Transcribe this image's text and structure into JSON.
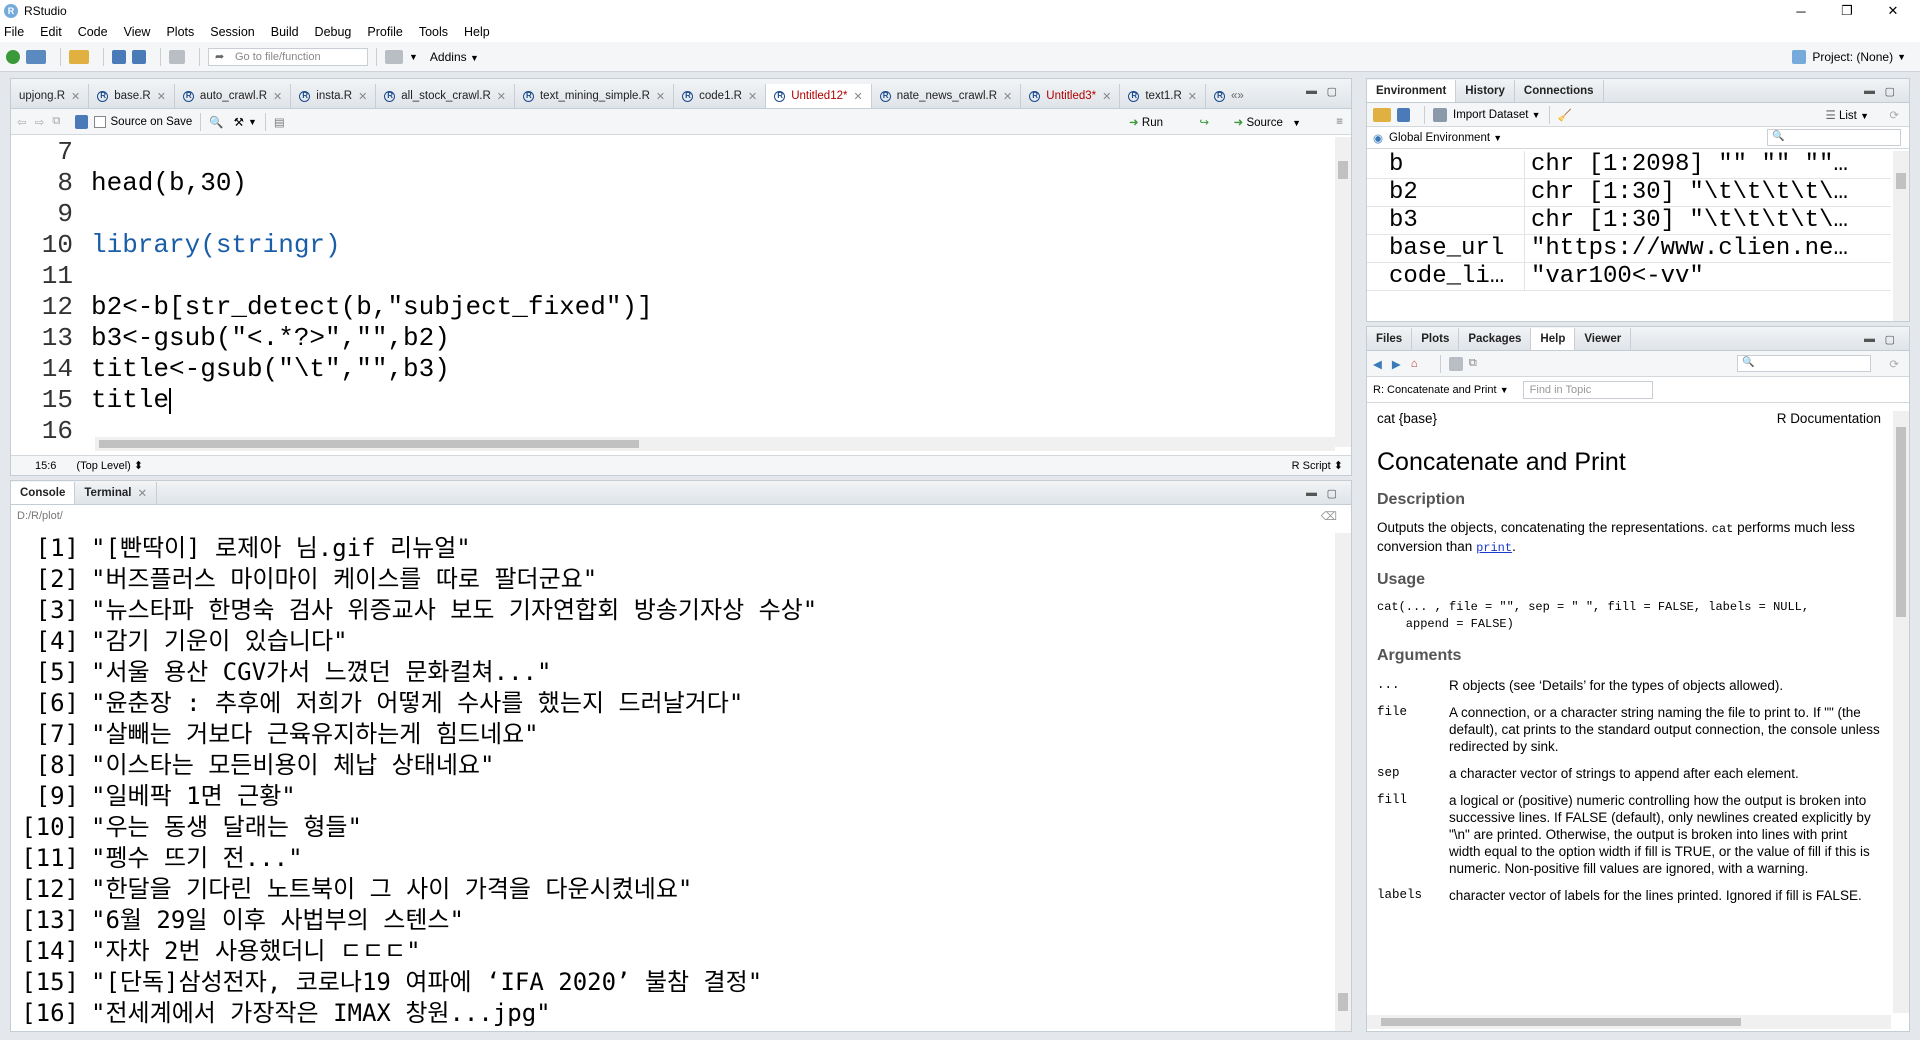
{
  "window": {
    "title": "RStudio",
    "min": "─",
    "max": "❐",
    "close": "✕"
  },
  "menu": [
    "File",
    "Edit",
    "Code",
    "View",
    "Plots",
    "Session",
    "Build",
    "Debug",
    "Profile",
    "Tools",
    "Help"
  ],
  "toolbar": {
    "goto_placeholder": "Go to file/function",
    "addins": "Addins",
    "project": "Project: (None)"
  },
  "editor": {
    "tabs": [
      {
        "label": "upjong.R",
        "unsaved": false,
        "active": false
      },
      {
        "label": "base.R",
        "unsaved": false,
        "active": false
      },
      {
        "label": "auto_crawl.R",
        "unsaved": false,
        "active": false
      },
      {
        "label": "insta.R",
        "unsaved": false,
        "active": false
      },
      {
        "label": "all_stock_crawl.R",
        "unsaved": false,
        "active": false
      },
      {
        "label": "text_mining_simple.R",
        "unsaved": false,
        "active": false
      },
      {
        "label": "code1.R",
        "unsaved": false,
        "active": false
      },
      {
        "label": "Untitled12*",
        "unsaved": true,
        "active": true
      },
      {
        "label": "nate_news_crawl.R",
        "unsaved": false,
        "active": false
      },
      {
        "label": "Untitled3*",
        "unsaved": true,
        "active": false
      },
      {
        "label": "text1.R",
        "unsaved": false,
        "active": false
      }
    ],
    "source_on_save": "Source on Save",
    "run": "Run",
    "source": "Source",
    "lines": [
      {
        "n": "7",
        "code": ""
      },
      {
        "n": "8",
        "code": "head(b,30)"
      },
      {
        "n": "9",
        "code": ""
      },
      {
        "n": "10",
        "code": "library(stringr)"
      },
      {
        "n": "11",
        "code": ""
      },
      {
        "n": "12",
        "code": "b2<-b[str_detect(b,\"subject_fixed\")]"
      },
      {
        "n": "13",
        "code": "b3<-gsub(\"<.*?>\",\"\",b2)"
      },
      {
        "n": "14",
        "code": "title<-gsub(\"\\t\",\"\",b3)"
      },
      {
        "n": "15",
        "code": "title"
      },
      {
        "n": "16",
        "code": ""
      }
    ],
    "status_pos": "15:6",
    "status_scope": "(Top Level) ⬍",
    "status_type": "R Script ⬍"
  },
  "console": {
    "tabs": [
      "Console",
      "Terminal"
    ],
    "path": "D:/R/plot/",
    "lines": [
      {
        "i": "[1]",
        "t": "\"[빤딱이] 로제아 님.gif 리뉴얼\""
      },
      {
        "i": "[2]",
        "t": "\"버즈플러스 마이마이 케이스를 따로 팔더군요\""
      },
      {
        "i": "[3]",
        "t": "\"뉴스타파 한명숙 검사 위증교사 보도 기자연합회 방송기자상 수상\""
      },
      {
        "i": "[4]",
        "t": "\"감기 기운이 있습니다\""
      },
      {
        "i": "[5]",
        "t": "\"서울 용산 CGV가서 느꼈던 문화컬쳐...\""
      },
      {
        "i": "[6]",
        "t": "\"윤춘장 : 추후에 저희가 어떻게 수사를 했는지 드러날거다\""
      },
      {
        "i": "[7]",
        "t": "\"살빼는 거보다 근육유지하는게 힘드네요\""
      },
      {
        "i": "[8]",
        "t": "\"이스타는 모든비용이 체납 상태네요\""
      },
      {
        "i": "[9]",
        "t": "\"일베팍 1면 근황\""
      },
      {
        "i": "[10]",
        "t": "\"우는 동생 달래는 형들\""
      },
      {
        "i": "[11]",
        "t": "\"펭수 뜨기 전...\""
      },
      {
        "i": "[12]",
        "t": "\"한달을 기다린 노트북이 그 사이 가격을 다운시켰네요\""
      },
      {
        "i": "[13]",
        "t": "\"6월 29일 이후 사법부의 스텐스\""
      },
      {
        "i": "[14]",
        "t": "\"자차 2번 사용했더니 ㄷㄷㄷ\""
      },
      {
        "i": "[15]",
        "t": "\"[단독]삼성전자, 코로나19 여파에 ‘IFA 2020’ 불참 결정\""
      },
      {
        "i": "[16]",
        "t": "\"전세계에서 가장작은 IMAX 창원...jpg\""
      }
    ]
  },
  "env": {
    "tabs": [
      "Environment",
      "History",
      "Connections"
    ],
    "import": "Import Dataset",
    "list": "List",
    "scope": "Global Environment",
    "rows": [
      {
        "name": "b",
        "value": "chr [1:2098] \"\" \"\" \"\"…"
      },
      {
        "name": "b2",
        "value": "chr [1:30] \"\\t\\t\\t\\t\\…"
      },
      {
        "name": "b3",
        "value": "chr [1:30] \"\\t\\t\\t\\t\\…"
      },
      {
        "name": "base_url",
        "value": "\"https://www.clien.ne…"
      },
      {
        "name": "code_li…",
        "value": "\"var100<-vv\""
      }
    ]
  },
  "files": {
    "tabs": [
      "Files",
      "Plots",
      "Packages",
      "Help",
      "Viewer"
    ],
    "topic": "R: Concatenate and Print",
    "find_placeholder": "Find in Topic",
    "help_pkg": "cat {base}",
    "help_doc": "R Documentation",
    "title": "Concatenate and Print",
    "h_desc": "Description",
    "desc": [
      "Outputs the objects, concatenating the representations. ",
      "cat",
      " performs much less conversion than ",
      "print",
      "."
    ],
    "h_usage": "Usage",
    "usage1": "cat(... , file = \"\", sep = \" \", fill = FALSE, labels = NULL,",
    "usage2": "    append = FALSE)",
    "h_args": "Arguments",
    "args": [
      {
        "name": "...",
        "desc": "R objects (see ‘Details’ for the types of objects allowed)."
      },
      {
        "name": "file",
        "desc": "A connection, or a character string naming the file to print to. If \"\" (the default), cat prints to the standard output connection, the console unless redirected by sink."
      },
      {
        "name": "sep",
        "desc": "a character vector of strings to append after each element."
      },
      {
        "name": "fill",
        "desc": "a logical or (positive) numeric controlling how the output is broken into successive lines. If FALSE (default), only newlines created explicitly by \"\\n\" are printed. Otherwise, the output is broken into lines with print width equal to the option width if fill is TRUE, or the value of fill if this is numeric. Non-positive fill values are ignored, with a warning."
      },
      {
        "name": "labels",
        "desc": "character vector of labels for the lines printed. Ignored if fill is FALSE."
      }
    ]
  }
}
